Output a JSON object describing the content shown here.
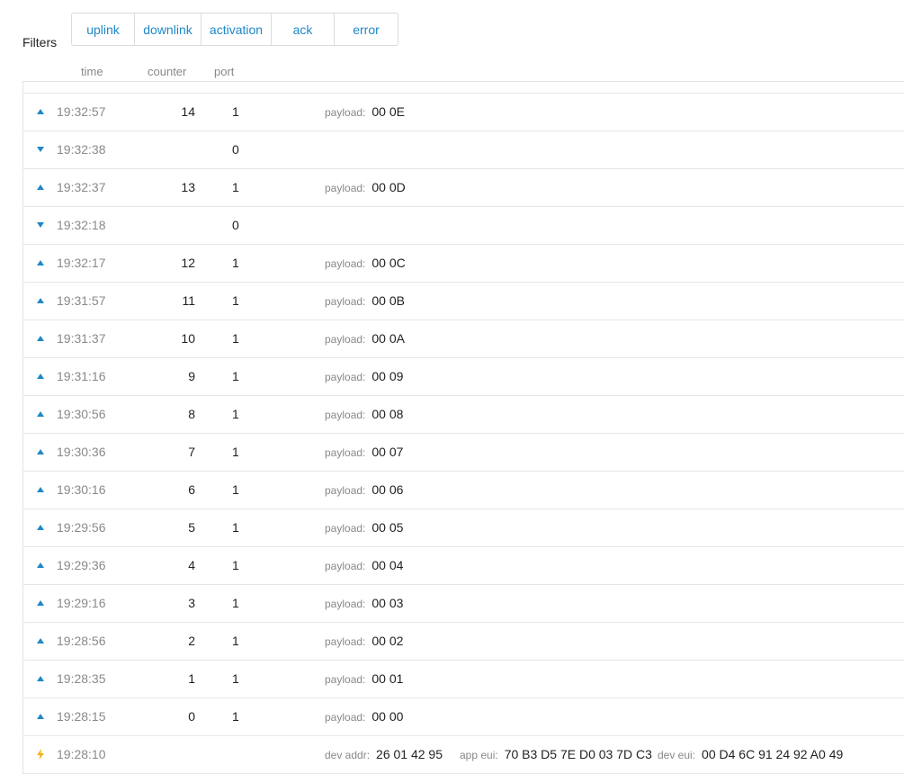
{
  "filters": {
    "label": "Filters",
    "buttons": [
      "uplink",
      "downlink",
      "activation",
      "ack",
      "error"
    ]
  },
  "columns": {
    "time": "time",
    "counter": "counter",
    "port": "port"
  },
  "colors": {
    "accent": "#1e88c7",
    "activation": "#f2b21b"
  },
  "rows": [
    {
      "type": "uplink",
      "icon": "uplink-arrow-icon",
      "time": "19:32:57",
      "counter": "14",
      "port": "1",
      "payload_label": "payload:",
      "payload": "00 0E"
    },
    {
      "type": "downlink",
      "icon": "downlink-arrow-icon",
      "time": "19:32:38",
      "counter": "",
      "port": "0",
      "payload_label": "",
      "payload": ""
    },
    {
      "type": "uplink",
      "icon": "uplink-arrow-icon",
      "time": "19:32:37",
      "counter": "13",
      "port": "1",
      "payload_label": "payload:",
      "payload": "00 0D"
    },
    {
      "type": "downlink",
      "icon": "downlink-arrow-icon",
      "time": "19:32:18",
      "counter": "",
      "port": "0",
      "payload_label": "",
      "payload": ""
    },
    {
      "type": "uplink",
      "icon": "uplink-arrow-icon",
      "time": "19:32:17",
      "counter": "12",
      "port": "1",
      "payload_label": "payload:",
      "payload": "00 0C"
    },
    {
      "type": "uplink",
      "icon": "uplink-arrow-icon",
      "time": "19:31:57",
      "counter": "11",
      "port": "1",
      "payload_label": "payload:",
      "payload": "00 0B"
    },
    {
      "type": "uplink",
      "icon": "uplink-arrow-icon",
      "time": "19:31:37",
      "counter": "10",
      "port": "1",
      "payload_label": "payload:",
      "payload": "00 0A"
    },
    {
      "type": "uplink",
      "icon": "uplink-arrow-icon",
      "time": "19:31:16",
      "counter": "9",
      "port": "1",
      "payload_label": "payload:",
      "payload": "00 09"
    },
    {
      "type": "uplink",
      "icon": "uplink-arrow-icon",
      "time": "19:30:56",
      "counter": "8",
      "port": "1",
      "payload_label": "payload:",
      "payload": "00 08"
    },
    {
      "type": "uplink",
      "icon": "uplink-arrow-icon",
      "time": "19:30:36",
      "counter": "7",
      "port": "1",
      "payload_label": "payload:",
      "payload": "00 07"
    },
    {
      "type": "uplink",
      "icon": "uplink-arrow-icon",
      "time": "19:30:16",
      "counter": "6",
      "port": "1",
      "payload_label": "payload:",
      "payload": "00 06"
    },
    {
      "type": "uplink",
      "icon": "uplink-arrow-icon",
      "time": "19:29:56",
      "counter": "5",
      "port": "1",
      "payload_label": "payload:",
      "payload": "00 05"
    },
    {
      "type": "uplink",
      "icon": "uplink-arrow-icon",
      "time": "19:29:36",
      "counter": "4",
      "port": "1",
      "payload_label": "payload:",
      "payload": "00 04"
    },
    {
      "type": "uplink",
      "icon": "uplink-arrow-icon",
      "time": "19:29:16",
      "counter": "3",
      "port": "1",
      "payload_label": "payload:",
      "payload": "00 03"
    },
    {
      "type": "uplink",
      "icon": "uplink-arrow-icon",
      "time": "19:28:56",
      "counter": "2",
      "port": "1",
      "payload_label": "payload:",
      "payload": "00 02"
    },
    {
      "type": "uplink",
      "icon": "uplink-arrow-icon",
      "time": "19:28:35",
      "counter": "1",
      "port": "1",
      "payload_label": "payload:",
      "payload": "00 01"
    },
    {
      "type": "uplink",
      "icon": "uplink-arrow-icon",
      "time": "19:28:15",
      "counter": "0",
      "port": "1",
      "payload_label": "payload:",
      "payload": "00 00"
    },
    {
      "type": "activation",
      "icon": "lightning-icon",
      "time": "19:28:10",
      "counter": "",
      "port": "",
      "dev_addr_label": "dev addr:",
      "dev_addr": "26 01 42 95",
      "app_eui_label": "app eui:",
      "app_eui": "70 B3 D5 7E D0 03 7D C3",
      "dev_eui_label": "dev eui:",
      "dev_eui": "00 D4 6C 91 24 92 A0 49"
    }
  ]
}
